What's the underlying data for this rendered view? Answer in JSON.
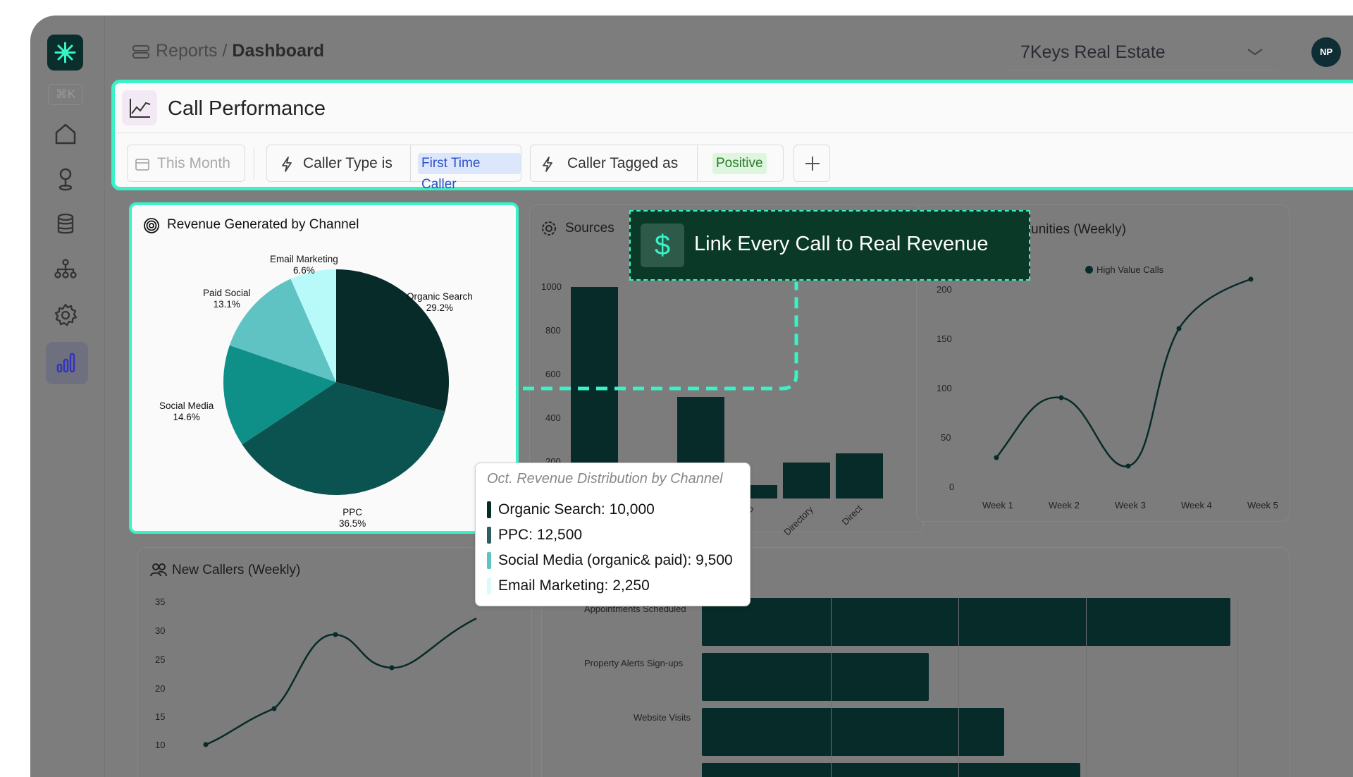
{
  "breadcrumb": {
    "parent": "Reports",
    "separator": "/",
    "current": "Dashboard"
  },
  "sidebar": {
    "shortcut": "⌘K",
    "items": [
      {
        "icon": "home-icon"
      },
      {
        "icon": "location-pin-icon"
      },
      {
        "icon": "database-icon"
      },
      {
        "icon": "sitemap-icon"
      },
      {
        "icon": "gear-icon"
      },
      {
        "icon": "bar-chart-icon",
        "active": true
      }
    ]
  },
  "header": {
    "org_name": "7Keys Real Estate",
    "avatar_initials": "NP"
  },
  "panel": {
    "title": "Call Performance",
    "filters": {
      "date_placeholder": "This Month",
      "caller_type_label": "Caller Type is",
      "caller_type_value": "First Time Caller",
      "tagged_label": "Caller Tagged as",
      "tagged_value": "Positive"
    }
  },
  "revenue_card": {
    "title": "Revenue Generated by Channel",
    "labels": [
      {
        "name": "Organic Search",
        "pct": "29.2%"
      },
      {
        "name": "PPC",
        "pct": "36.5%"
      },
      {
        "name": "Social Media",
        "pct": "14.6%"
      },
      {
        "name": "Paid Social",
        "pct": "13.1%"
      },
      {
        "name": "Email Marketing",
        "pct": "6.6%"
      }
    ]
  },
  "callout": {
    "icon": "dollar-icon",
    "text": "Link Every Call to Real Revenue"
  },
  "tooltip": {
    "title": "Oct. Revenue Distribution by Channel",
    "rows": [
      {
        "text": "Organic Search: 10,000",
        "color": "#062b29"
      },
      {
        "text": "PPC: 12,500",
        "color": "#2b5f63"
      },
      {
        "text": "Social Media (organic& paid): 9,500",
        "color": "#5fc2c3"
      },
      {
        "text": "Email Marketing: 2,250",
        "color": "#d9fbfb"
      }
    ]
  },
  "sources_card": {
    "title": "Sources",
    "yticks": [
      "1000",
      "800",
      "600",
      "400",
      "200"
    ],
    "xlabels": [
      "B",
      "Directory",
      "Direct"
    ]
  },
  "opportunities_card": {
    "title": "ortunities (Weekly)",
    "legend": "High Value Calls",
    "yticks": [
      "200",
      "150",
      "100",
      "50",
      "0"
    ],
    "xlabels": [
      "Week 1",
      "Week 2",
      "Week 3",
      "Week 4",
      "Week 5"
    ]
  },
  "new_callers_card": {
    "title": "New Callers (Weekly)",
    "yticks": [
      "35",
      "30",
      "25",
      "20",
      "15",
      "10"
    ]
  },
  "funnel_card": {
    "labels": [
      "Appointments Scheduled",
      "Property Alerts Sign-ups",
      "Website Visits"
    ]
  },
  "chart_data": {
    "type": "pie",
    "title": "Revenue Generated by Channel",
    "categories": [
      "Organic Search",
      "PPC",
      "Social Media",
      "Paid Social",
      "Email Marketing"
    ],
    "values": [
      29.2,
      36.5,
      14.6,
      13.1,
      6.6
    ],
    "colors": [
      "#062b29",
      "#0b5351",
      "#0e8f88",
      "#5fc2c3",
      "#b8fafa"
    ]
  },
  "colors": {
    "accent": "#39f2c5",
    "brand_dark": "#0a3a27"
  }
}
